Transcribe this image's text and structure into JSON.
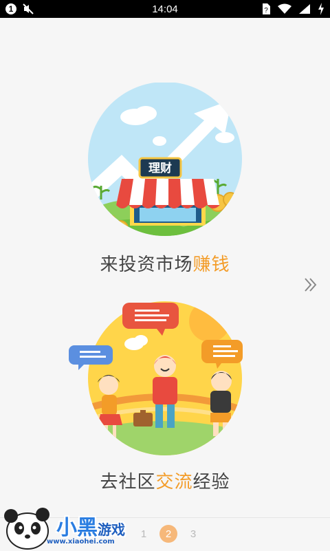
{
  "status_bar": {
    "time": "14:04",
    "notification_count": "1",
    "icons": [
      "mute-icon",
      "sim-unknown-icon",
      "wifi-icon",
      "signal-icon",
      "battery-charging-icon"
    ]
  },
  "slides": [
    {
      "sign": "理财",
      "caption_plain": "来投资市场",
      "caption_highlight": "赚钱"
    },
    {
      "caption_plain": "去社区",
      "caption_highlight": "交流",
      "caption_plain2": "经验"
    }
  ],
  "pager": {
    "pages": [
      "1",
      "2",
      "3"
    ],
    "current": "2"
  },
  "watermark": {
    "brand": "小黑",
    "game": "游戏",
    "url": "www.xiaohei.com"
  },
  "colors": {
    "accent": "#f39c28",
    "background": "#f6f6f6",
    "pager_active": "#f6b87a"
  }
}
